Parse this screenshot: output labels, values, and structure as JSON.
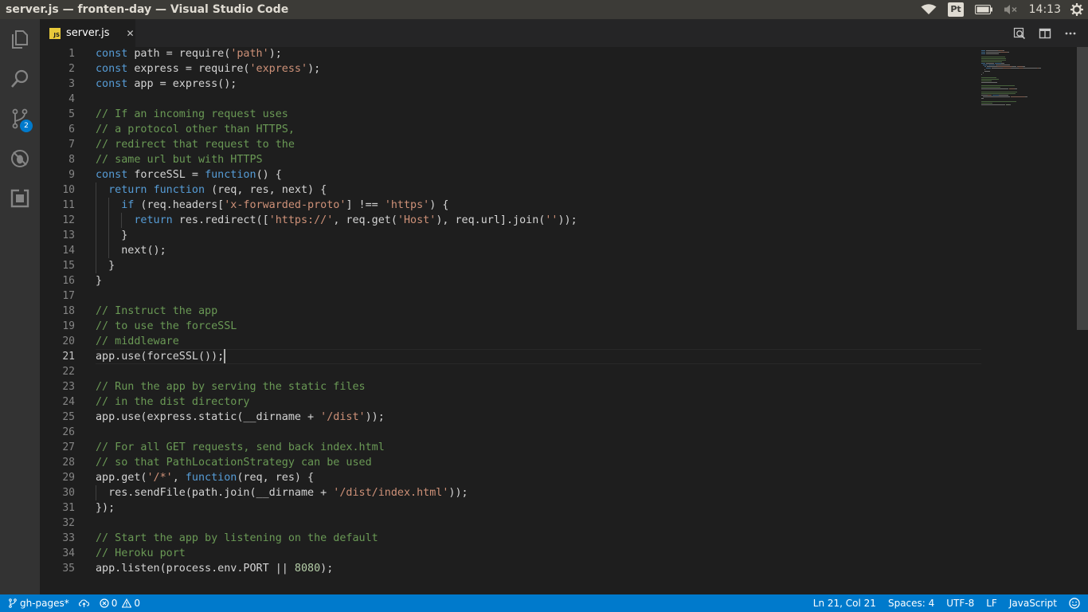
{
  "window": {
    "title": "server.js — fronten-day — Visual Studio Code"
  },
  "tray": {
    "keyboard_layout": "Pt",
    "clock": "14:13",
    "icons": [
      "wifi-icon",
      "keyboard-layout-indicator",
      "battery-icon",
      "volume-muted-icon",
      "settings-gear-icon"
    ]
  },
  "activity_bar": {
    "items": [
      {
        "name": "explorer",
        "icon": "files-icon"
      },
      {
        "name": "search",
        "icon": "search-icon"
      },
      {
        "name": "source-control",
        "icon": "git-branch-icon",
        "badge": "2"
      },
      {
        "name": "debug",
        "icon": "bug-icon"
      },
      {
        "name": "extensions",
        "icon": "extensions-icon"
      }
    ]
  },
  "tabs": [
    {
      "label": "server.js",
      "icon": "js-file-icon",
      "active": true
    }
  ],
  "editor_actions": [
    "open-changes-icon",
    "split-editor-icon",
    "more-actions-icon"
  ],
  "editor": {
    "active_line": 21,
    "lines": [
      [
        [
          "k",
          "const"
        ],
        [
          "t",
          " path = require("
        ],
        [
          "s",
          "'path'"
        ],
        [
          "t",
          ");"
        ]
      ],
      [
        [
          "k",
          "const"
        ],
        [
          "t",
          " express = require("
        ],
        [
          "s",
          "'express'"
        ],
        [
          "t",
          ");"
        ]
      ],
      [
        [
          "k",
          "const"
        ],
        [
          "t",
          " app = express();"
        ]
      ],
      [],
      [
        [
          "c",
          "// If an incoming request uses"
        ]
      ],
      [
        [
          "c",
          "// a protocol other than HTTPS,"
        ]
      ],
      [
        [
          "c",
          "// redirect that request to the"
        ]
      ],
      [
        [
          "c",
          "// same url but with HTTPS"
        ]
      ],
      [
        [
          "k",
          "const"
        ],
        [
          "t",
          " forceSSL = "
        ],
        [
          "k",
          "function"
        ],
        [
          "t",
          "() {"
        ]
      ],
      [
        [
          "t",
          "  "
        ],
        [
          "k",
          "return"
        ],
        [
          "t",
          " "
        ],
        [
          "k",
          "function"
        ],
        [
          "t",
          " (req, res, next) {"
        ]
      ],
      [
        [
          "t",
          "    "
        ],
        [
          "k",
          "if"
        ],
        [
          "t",
          " (req.headers["
        ],
        [
          "s",
          "'x-forwarded-proto'"
        ],
        [
          "t",
          "] !== "
        ],
        [
          "s",
          "'https'"
        ],
        [
          "t",
          ") {"
        ]
      ],
      [
        [
          "t",
          "      "
        ],
        [
          "k",
          "return"
        ],
        [
          "t",
          " res.redirect(["
        ],
        [
          "s",
          "'https://'"
        ],
        [
          "t",
          ", req.get("
        ],
        [
          "s",
          "'Host'"
        ],
        [
          "t",
          "), req.url].join("
        ],
        [
          "s",
          "''"
        ],
        [
          "t",
          "));"
        ]
      ],
      [
        [
          "t",
          "    }"
        ]
      ],
      [
        [
          "t",
          "    next();"
        ]
      ],
      [
        [
          "t",
          "  }"
        ]
      ],
      [
        [
          "t",
          "}"
        ]
      ],
      [],
      [
        [
          "c",
          "// Instruct the app"
        ]
      ],
      [
        [
          "c",
          "// to use the forceSSL"
        ]
      ],
      [
        [
          "c",
          "// middleware"
        ]
      ],
      [
        [
          "t",
          "app.use(forceSSL());"
        ]
      ],
      [],
      [
        [
          "c",
          "// Run the app by serving the static files"
        ]
      ],
      [
        [
          "c",
          "// in the dist directory"
        ]
      ],
      [
        [
          "t",
          "app.use(express.static(__dirname + "
        ],
        [
          "s",
          "'/dist'"
        ],
        [
          "t",
          "));"
        ]
      ],
      [],
      [
        [
          "c",
          "// For all GET requests, send back index.html"
        ]
      ],
      [
        [
          "c",
          "// so that PathLocationStrategy can be used"
        ]
      ],
      [
        [
          "t",
          "app.get("
        ],
        [
          "s",
          "'/*'"
        ],
        [
          "t",
          ", "
        ],
        [
          "k",
          "function"
        ],
        [
          "t",
          "(req, res) {"
        ]
      ],
      [
        [
          "t",
          "  res.sendFile(path.join(__dirname + "
        ],
        [
          "s",
          "'/dist/index.html'"
        ],
        [
          "t",
          "));"
        ]
      ],
      [
        [
          "t",
          "});"
        ]
      ],
      [],
      [
        [
          "c",
          "// Start the app by listening on the default"
        ]
      ],
      [
        [
          "c",
          "// Heroku port"
        ]
      ],
      [
        [
          "t",
          "app.listen(process.env.PORT || "
        ],
        [
          "n",
          "8080"
        ],
        [
          "t",
          ");"
        ]
      ]
    ]
  },
  "status_bar": {
    "branch": "gh-pages*",
    "errors": "0",
    "warnings": "0",
    "position": "Ln 21, Col 21",
    "indentation": "Spaces: 4",
    "encoding": "UTF-8",
    "eol": "LF",
    "language": "JavaScript"
  },
  "colors": {
    "status_bar": "#007acc",
    "keyword": "#569cd6",
    "string": "#ce9178",
    "comment": "#6a9955",
    "number": "#b5cea8"
  }
}
